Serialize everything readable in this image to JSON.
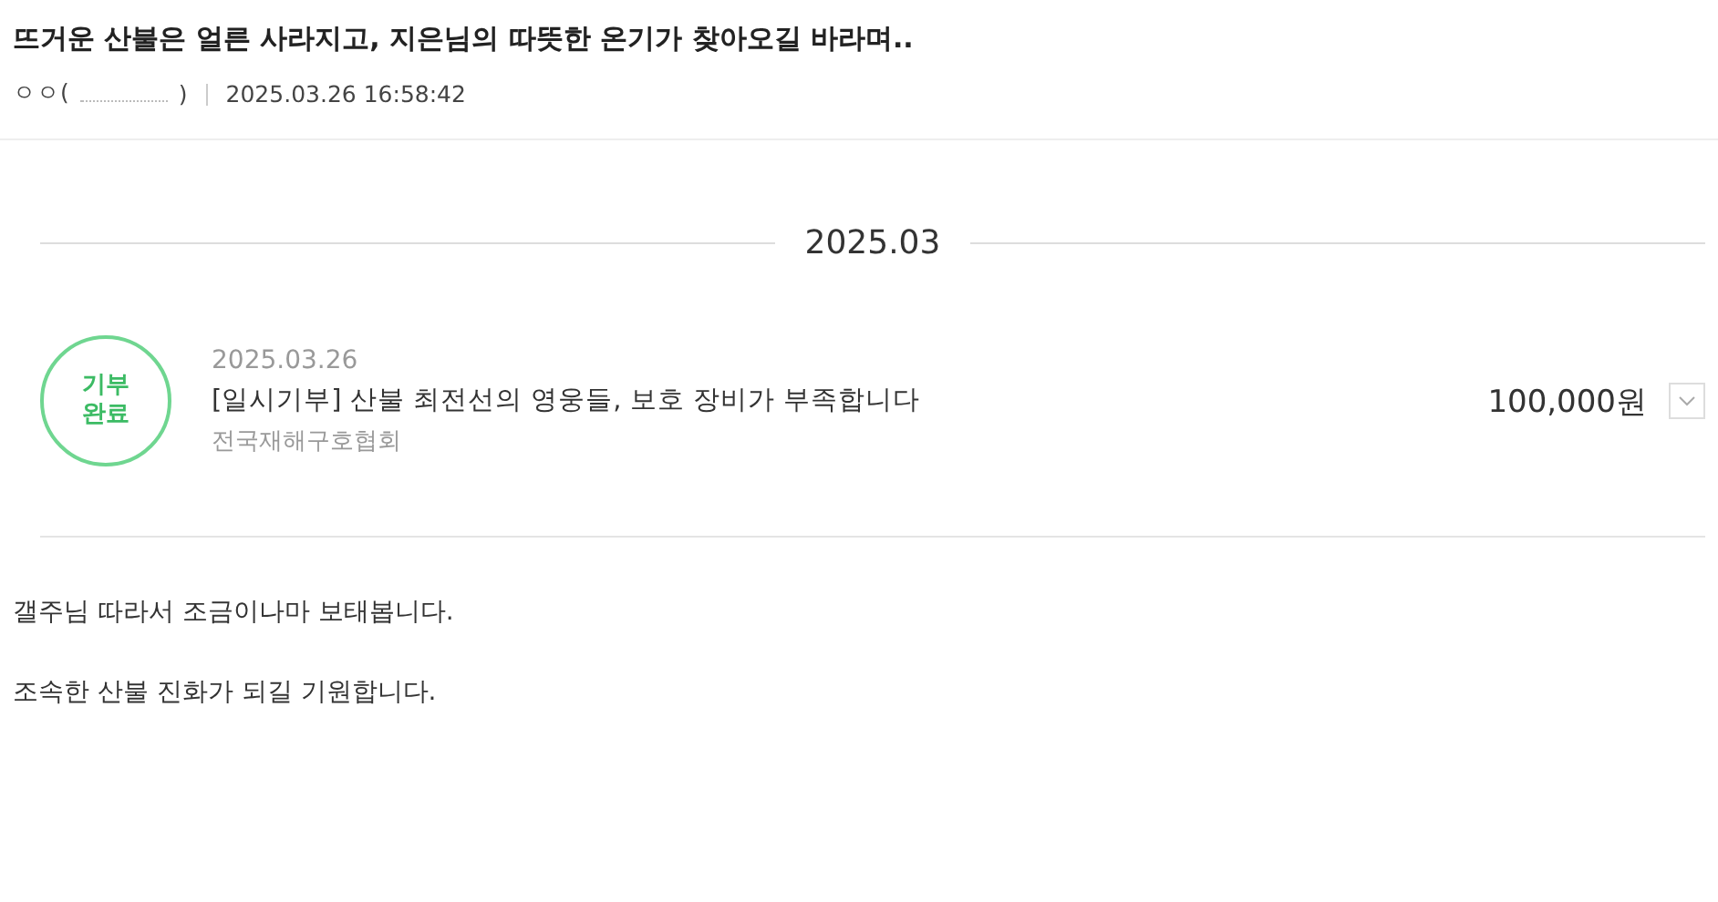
{
  "post": {
    "title": "뜨거운 산불은 얼른 사라지고, 지은님의 따뜻한 온기가 찾아오길 바라며..",
    "author": "ㅇㅇ(",
    "author_end": ")",
    "datetime": "2025.03.26 16:58:42"
  },
  "month": "2025.03",
  "donation": {
    "status_lines": [
      "기부",
      "완료"
    ],
    "date": "2025.03.26",
    "title": "[일시기부] 산불 최전선의 영웅들, 보호 장비가 부족합니다",
    "organization": "전국재해구호협회",
    "amount": "100,000원",
    "expanded": false
  },
  "paragraphs": [
    "갤주님 따라서 조금이나마 보태봅니다.",
    "조속한 산불 진화가 되길 기원합니다."
  ]
}
